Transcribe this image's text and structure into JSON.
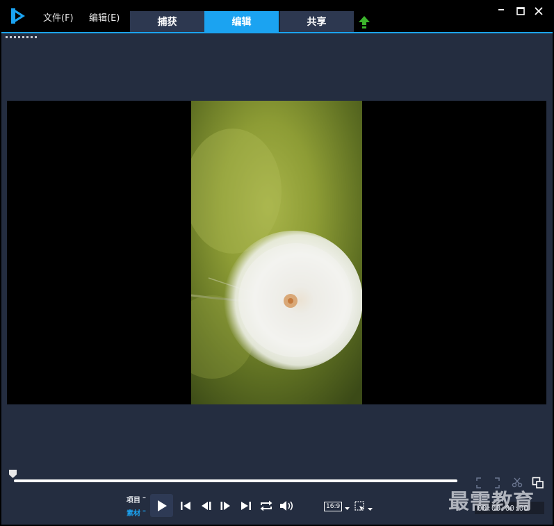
{
  "menu": {
    "file": "文件(F)",
    "edit": "编辑(E)"
  },
  "tabs": [
    {
      "label": "捕获",
      "active": false
    },
    {
      "label": "编辑",
      "active": true
    },
    {
      "label": "共享",
      "active": false
    }
  ],
  "preview": {
    "image": "dandelion-seed-head"
  },
  "playback": {
    "mode_project": "项目",
    "mode_clip": "素材",
    "active_mode": "clip",
    "aspect_ratio": "16:9",
    "timecode": "00:00:00:00",
    "scrubber_position": 0
  },
  "watermark": "最需教育",
  "colors": {
    "accent": "#1ba3f1",
    "background": "#242d40",
    "titlebar": "#000000",
    "upload": "#3cb52c"
  },
  "icons": [
    "app-logo-icon",
    "upload-icon",
    "minimize-icon",
    "maximize-icon",
    "close-icon",
    "play-icon",
    "skip-start-icon",
    "step-back-icon",
    "step-forward-icon",
    "skip-end-icon",
    "repeat-icon",
    "volume-icon",
    "crop-icon",
    "scissors-icon",
    "enlarge-icon"
  ]
}
